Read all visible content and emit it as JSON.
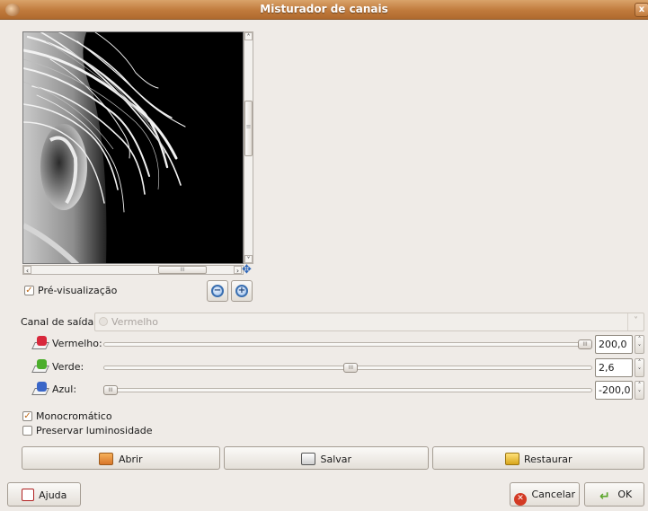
{
  "window": {
    "title": "Misturador de canais",
    "close_glyph": "x"
  },
  "preview": {
    "show_label": "Pré-visualização",
    "show_checked": true,
    "hscroll_thumb_glyph": "III",
    "vscroll_thumb_glyph": "≡",
    "zoom_out_icon": "zoom-out-icon",
    "zoom_in_icon": "zoom-in-icon",
    "nav_icon": "navigate-move-icon"
  },
  "output_channel": {
    "label": "Canal de saída:",
    "value": "Vermelho",
    "enabled": false
  },
  "channels": [
    {
      "label": "Vermelho:",
      "value": "200,0",
      "color": "#d8283c",
      "level_fraction": 1.0
    },
    {
      "label": "Verde:",
      "value": "2,6",
      "color": "#4cae2c",
      "level_fraction": 0.5065
    },
    {
      "label": "Azul:",
      "value": "-200,0",
      "color": "#3a66c8",
      "level_fraction": 0.0
    }
  ],
  "options": {
    "monochrome_label": "Monocromático",
    "monochrome_checked": true,
    "preserve_label": "Preservar luminosidade",
    "preserve_checked": false
  },
  "actions": {
    "open": "Abrir",
    "save": "Salvar",
    "reset": "Restaurar"
  },
  "footer": {
    "help": "Ajuda",
    "cancel": "Cancelar",
    "ok": "OK"
  },
  "colors": {
    "titlebar": "#c07a3c",
    "dialog_bg": "#efebe7",
    "checkbox_check": "#c06a18",
    "cancel_icon": "#d33a24",
    "ok_icon": "#5aa52a"
  }
}
